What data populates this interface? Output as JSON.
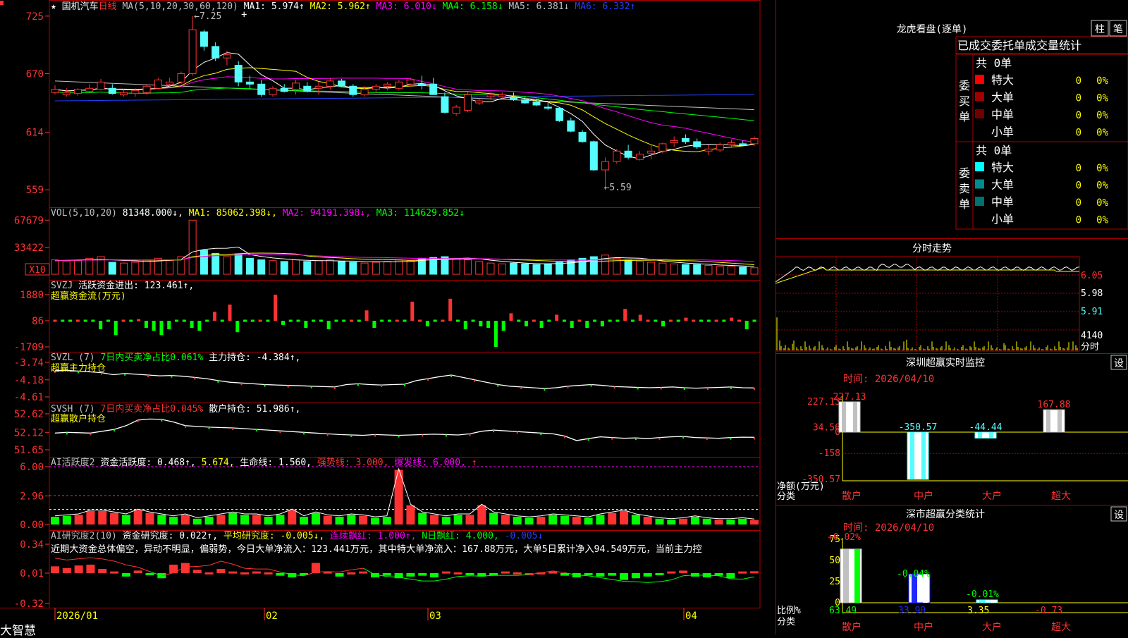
{
  "app": {
    "brand": "大智慧"
  },
  "header": {
    "star": "★",
    "stock_name": "国机汽车",
    "period": "日线",
    "ma_param": "MA(5,10,20,30,60,120)",
    "ma_items": [
      {
        "text": "MA1: 5.974↑",
        "color": "#ffffff"
      },
      {
        "text": "MA2: 5.962↑",
        "color": "#ffff00"
      },
      {
        "text": "MA3: 6.010↓",
        "color": "#ff00ff"
      },
      {
        "text": "MA4: 6.158↓",
        "color": "#00ff00"
      },
      {
        "text": "MA5: 6.381↓",
        "color": "#c0c0c0"
      },
      {
        "text": "MA6: 6.332↑",
        "color": "#2040ff"
      }
    ],
    "plus": "+"
  },
  "price_axis": [
    "725",
    "670",
    "614",
    "559"
  ],
  "price_annotations": {
    "high": "←7.25",
    "low": "←5.59"
  },
  "vol": {
    "title": "VOL(5,10,20)",
    "value": "81348.000↓,",
    "ma1": "MA1: 85062.398↓,",
    "ma2": "MA2: 94191.398↓,",
    "ma3": "MA3: 114629.852↓",
    "axis": [
      "67679",
      "33422"
    ],
    "unit": "X10"
  },
  "svzj": {
    "title": "SVZJ",
    "text": "活跃资金进出: 123.461↑,",
    "sub": "超赢资金流(万元)",
    "axis": [
      "1880",
      "86",
      "-1709"
    ]
  },
  "svzl": {
    "title": "SVZL (7)",
    "t1": "7日内买卖净占比0.061%",
    "t2": "主力持仓: -4.384↑,",
    "sub": "超赢主力持仓",
    "axis": [
      "-3.74",
      "-4.18",
      "-4.61"
    ]
  },
  "svsh": {
    "title": "SVSH (7)",
    "t1": "7日内买卖净占比0.045%",
    "t2": "散户持仓: 51.986↑,",
    "sub": "超赢散户持仓",
    "axis": [
      "52.62",
      "52.12",
      "51.65"
    ]
  },
  "ai1": {
    "title": "AI活跃度2",
    "t1": "资金活跃度: 0.468↑,",
    "t2": "5.674,",
    "t3": "生命线: 1.560,",
    "t4": "强势线: 3.000,",
    "t5": "爆发线: 6.000,",
    "t6": "↑",
    "axis": [
      "6.00",
      "2.96",
      "0.00"
    ]
  },
  "ai2": {
    "title": "AI研究度2(10)",
    "t1": "资金研究度: 0.022↑,",
    "t2": "平均研究度: -0.005↓,",
    "t3": "连续飘红: 1.000↑,",
    "t4": "N日飘红: 4.000,",
    "t5": "-0.005↓",
    "comment": "近期大资金总体偏空，异动不明显，偏弱势，今日大单净流入：123.441万元，其中特大单净流入：167.88万元，大单5日累计净入94.549万元，当前主力控",
    "axis": [
      "0.34",
      "0.01",
      "-0.32"
    ]
  },
  "date_axis": [
    "2026/01",
    "02",
    "03",
    "04"
  ],
  "dragon": {
    "title": "龙虎看盘(逐单)",
    "btn1": "柱",
    "btn2": "笔",
    "tabs": "已成交委托单成交量统计",
    "buy": {
      "side": "委买单",
      "total": "共 0单",
      "rows": [
        {
          "label": "特大",
          "color": "#ff0000",
          "v": "0",
          "p": "0%"
        },
        {
          "label": "大单",
          "color": "#a00000",
          "v": "0",
          "p": "0%"
        },
        {
          "label": "中单",
          "color": "#700000",
          "v": "0",
          "p": "0%"
        },
        {
          "label": "小单",
          "color": "#000000",
          "v": "0",
          "p": "0%"
        }
      ]
    },
    "sell": {
      "side": "委卖单",
      "total": "共 0单",
      "rows": [
        {
          "label": "特大",
          "color": "#00ffff",
          "v": "0",
          "p": "0%"
        },
        {
          "label": "大单",
          "color": "#008c8c",
          "v": "0",
          "p": "0%"
        },
        {
          "label": "中单",
          "color": "#007070",
          "v": "0",
          "p": "0%"
        },
        {
          "label": "小单",
          "color": "#000000",
          "v": "0",
          "p": "0%"
        }
      ]
    }
  },
  "fenshi": {
    "title": "分时走势",
    "axis": [
      "6.05",
      "5.98",
      "5.91"
    ],
    "vol": "4140",
    "unit": "分时"
  },
  "monitor": {
    "title": "深圳超赢实时监控",
    "setting": "设",
    "time": "时间: 2026/04/10",
    "axis": [
      "227.13",
      "34.56",
      "0",
      "-158",
      "-350.57"
    ],
    "ylabel": "净额(万元)",
    "xlabel": "分类",
    "cats": [
      "散户",
      "中户",
      "大户",
      "超大"
    ],
    "values": [
      "227.13",
      "-350.57",
      "-44.44",
      "167.88"
    ]
  },
  "stats": {
    "title": "深市超赢分类统计",
    "setting": "设",
    "time": "时间: 2026/04/10",
    "axis": [
      "75",
      "50",
      "25",
      "0"
    ],
    "ylabel": "比例%",
    "xlabel": "分类",
    "cats": [
      "散户",
      "中户",
      "大户",
      "超大"
    ],
    "top": [
      "+0.02%",
      "-0.04%",
      "-0.01%",
      ""
    ],
    "bottom": [
      "63.49",
      "33.90",
      "3.35",
      "-0.73"
    ]
  },
  "chart_data": {
    "type": "candlestick",
    "title": "国机汽车 日线",
    "x_start": "2026/01",
    "ylim": [
      5.45,
      7.35
    ],
    "ohlc": [
      [
        6.52,
        6.59,
        6.5,
        6.55
      ],
      [
        6.5,
        6.56,
        6.48,
        6.52
      ],
      [
        6.51,
        6.56,
        6.49,
        6.55
      ],
      [
        6.53,
        6.6,
        6.52,
        6.56
      ],
      [
        6.55,
        6.65,
        6.54,
        6.62
      ],
      [
        6.56,
        6.6,
        6.5,
        6.51
      ],
      [
        6.5,
        6.55,
        6.48,
        6.52
      ],
      [
        6.51,
        6.56,
        6.48,
        6.54
      ],
      [
        6.52,
        6.6,
        6.5,
        6.58
      ],
      [
        6.56,
        6.66,
        6.55,
        6.64
      ],
      [
        6.6,
        6.66,
        6.58,
        6.62
      ],
      [
        6.62,
        6.72,
        6.6,
        6.7
      ],
      [
        6.7,
        7.25,
        6.68,
        7.12
      ],
      [
        7.1,
        7.12,
        6.92,
        6.96
      ],
      [
        6.96,
        7.0,
        6.82,
        6.85
      ],
      [
        6.85,
        6.92,
        6.78,
        6.88
      ],
      [
        6.78,
        6.82,
        6.58,
        6.62
      ],
      [
        6.62,
        6.68,
        6.55,
        6.6
      ],
      [
        6.6,
        6.64,
        6.48,
        6.5
      ],
      [
        6.5,
        6.58,
        6.48,
        6.56
      ],
      [
        6.56,
        6.6,
        6.52,
        6.53
      ],
      [
        6.55,
        6.64,
        6.5,
        6.61
      ],
      [
        6.58,
        6.62,
        6.52,
        6.53
      ],
      [
        6.56,
        6.62,
        6.5,
        6.58
      ],
      [
        6.58,
        6.66,
        6.55,
        6.63
      ],
      [
        6.63,
        6.65,
        6.57,
        6.58
      ],
      [
        6.58,
        6.6,
        6.48,
        6.5
      ],
      [
        6.5,
        6.58,
        6.48,
        6.55
      ],
      [
        6.55,
        6.6,
        6.52,
        6.58
      ],
      [
        6.58,
        6.62,
        6.54,
        6.6
      ],
      [
        6.56,
        6.64,
        6.54,
        6.62
      ],
      [
        6.6,
        6.66,
        6.58,
        6.64
      ],
      [
        6.6,
        6.68,
        6.55,
        6.59
      ],
      [
        6.6,
        6.66,
        6.5,
        6.5
      ],
      [
        6.48,
        6.52,
        6.32,
        6.33
      ],
      [
        6.32,
        6.4,
        6.3,
        6.38
      ],
      [
        6.35,
        6.52,
        6.33,
        6.5
      ],
      [
        6.42,
        6.46,
        6.4,
        6.44
      ],
      [
        6.48,
        6.52,
        6.45,
        6.5
      ],
      [
        6.48,
        6.52,
        6.46,
        6.5
      ],
      [
        6.47,
        6.52,
        6.44,
        6.45
      ],
      [
        6.45,
        6.48,
        6.41,
        6.42
      ],
      [
        6.43,
        6.46,
        6.39,
        6.4
      ],
      [
        6.38,
        6.42,
        6.35,
        6.37
      ],
      [
        6.37,
        6.38,
        6.24,
        6.25
      ],
      [
        6.25,
        6.28,
        6.14,
        6.15
      ],
      [
        6.14,
        6.16,
        6.04,
        6.05
      ],
      [
        6.05,
        6.06,
        5.77,
        5.78
      ],
      [
        5.78,
        5.9,
        5.59,
        5.86
      ],
      [
        5.86,
        5.98,
        5.84,
        5.96
      ],
      [
        5.96,
        6.02,
        5.88,
        5.9
      ],
      [
        5.88,
        5.96,
        5.87,
        5.93
      ],
      [
        5.94,
        6.02,
        5.88,
        5.96
      ],
      [
        5.96,
        6.04,
        5.94,
        6.03
      ],
      [
        6.04,
        6.1,
        6.0,
        6.06
      ],
      [
        6.08,
        6.12,
        6.03,
        6.05
      ],
      [
        6.05,
        6.08,
        5.98,
        6.0
      ],
      [
        5.96,
        6.02,
        5.92,
        5.98
      ],
      [
        5.97,
        6.04,
        5.95,
        6.02
      ],
      [
        6.02,
        6.07,
        5.99,
        6.04
      ],
      [
        6.03,
        6.06,
        6.01,
        6.02
      ],
      [
        6.03,
        6.1,
        6.01,
        6.08
      ]
    ],
    "volume_ylim": [
      0,
      75000
    ],
    "volume": [
      18000,
      16000,
      17000,
      20000,
      22000,
      15000,
      14000,
      15000,
      18000,
      20000,
      17000,
      22000,
      67679,
      30000,
      26000,
      22000,
      25000,
      20000,
      18000,
      17000,
      16000,
      18000,
      16000,
      17000,
      18000,
      16000,
      15000,
      14000,
      15000,
      16000,
      18000,
      17000,
      20000,
      21000,
      22000,
      20000,
      18000,
      16000,
      14000,
      13000,
      14000,
      13000,
      12000,
      13000,
      15000,
      18000,
      20000,
      22000,
      24000,
      20000,
      18000,
      16000,
      15000,
      14000,
      13000,
      12000,
      12000,
      11000,
      10000,
      10000,
      9000,
      8134
    ],
    "vol_ma5": [
      17000,
      17500,
      17800,
      18200,
      18600,
      18000,
      17200,
      16800,
      16000,
      16600,
      17500,
      18500,
      28000,
      31000,
      32500,
      32600,
      34100,
      24600,
      22200,
      20400,
      19200,
      18000,
      17400,
      17000,
      17000,
      16600,
      16400,
      15800,
      15600,
      15400,
      15600,
      16000,
      17200,
      18400,
      19600,
      19800,
      20200,
      19400,
      17600,
      16200,
      15000,
      14000,
      13200,
      13000,
      13400,
      14200,
      15600,
      17800,
      19800,
      20800,
      20400,
      20000,
      18600,
      16600,
      15200,
      14000,
      13200,
      12400,
      11600,
      11000,
      10400,
      9627
    ],
    "vol_ma10": [
      17000,
      17200,
      17400,
      17700,
      18000,
      18100,
      18000,
      17900,
      17600,
      17600,
      17700,
      17800,
      22000,
      23500,
      24500,
      24800,
      25700,
      26400,
      26500,
      26400,
      26000,
      25300,
      22900,
      21600,
      21000,
      20300,
      19400,
      18800,
      18400,
      18300,
      17900,
      17400,
      17800,
      18100,
      18500,
      18700,
      19000,
      19300,
      19000,
      18700,
      18200,
      17700,
      17300,
      16700,
      16200,
      15900,
      15700,
      15900,
      16400,
      17000,
      17200,
      17400,
      17600,
      17700,
      17500,
      17000,
      16500,
      15600,
      14800,
      13900,
      13000,
      11900
    ],
    "vol_ma20": [
      17500,
      17500,
      17600,
      17700,
      17800,
      17800,
      17800,
      17800,
      17800,
      17900,
      18000,
      18100,
      21000,
      22200,
      23100,
      23500,
      24100,
      24400,
      24500,
      24500,
      24500,
      24400,
      23600,
      22900,
      22300,
      21900,
      21400,
      21100,
      20900,
      20700,
      20400,
      20100,
      19800,
      19600,
      19500,
      19500,
      19600,
      19500,
      19300,
      19000,
      18800,
      18500,
      18400,
      18100,
      17900,
      17700,
      17600,
      17800,
      18000,
      18300,
      18400,
      18600,
      18600,
      18500,
      18300,
      18100,
      18000,
      17700,
      17400,
      17200,
      16600,
      15900
    ],
    "svzj": [
      86,
      86,
      86,
      86,
      86,
      86,
      -500,
      86,
      -900,
      86,
      86,
      200,
      -400,
      -600,
      -900,
      -500,
      86,
      86,
      -400,
      -600,
      86,
      700,
      86,
      1200,
      -700,
      86,
      86,
      86,
      86,
      1880,
      -200,
      86,
      86,
      -400,
      86,
      86,
      -500,
      86,
      86,
      86,
      86,
      800,
      -400,
      86,
      86,
      86,
      86,
      1400,
      86,
      -300,
      86,
      86,
      1600,
      86,
      -500,
      86,
      -300,
      -400,
      -1709,
      -600,
      600,
      86,
      -300,
      86,
      -400,
      86,
      500,
      86,
      -400,
      86,
      -400,
      86,
      -300,
      86,
      86,
      900,
      86,
      500,
      86,
      86,
      -300,
      86,
      86,
      300,
      86,
      86,
      86,
      86,
      86,
      300,
      86,
      -500,
      86
    ],
    "svzl": [
      -3.95,
      -3.94,
      -3.96,
      -3.98,
      -4.0,
      -4.05,
      -4.02,
      -4.04,
      -4.06,
      -4.08,
      -4.07,
      -4.09,
      -4.12,
      -4.15,
      -4.2,
      -4.24,
      -4.26,
      -4.28,
      -4.3,
      -4.31,
      -4.32,
      -4.33,
      -4.34,
      -4.35,
      -4.36,
      -4.3,
      -4.28,
      -4.3,
      -4.31,
      -4.3,
      -4.29,
      -4.2,
      -4.15,
      -4.1,
      -4.06,
      -4.12,
      -4.18,
      -4.24,
      -4.3,
      -4.34,
      -4.36,
      -4.38,
      -4.4,
      -4.38,
      -4.34,
      -4.32,
      -4.3,
      -4.32,
      -4.35,
      -4.36,
      -4.37,
      -4.38,
      -4.37,
      -4.36,
      -4.38,
      -4.39,
      -4.38,
      -4.37,
      -4.36,
      -4.38,
      -4.384
    ],
    "svsh": [
      52.1,
      52.12,
      52.11,
      52.1,
      52.15,
      52.2,
      52.3,
      52.45,
      52.48,
      52.47,
      52.4,
      52.3,
      52.28,
      52.26,
      52.25,
      52.24,
      52.22,
      52.2,
      52.18,
      52.16,
      52.14,
      52.12,
      52.1,
      52.08,
      52.06,
      52.05,
      52.04,
      52.06,
      52.05,
      52.04,
      52.05,
      52.06,
      52.07,
      52.06,
      52.05,
      52.08,
      52.15,
      52.18,
      52.16,
      52.14,
      52.12,
      52.1,
      52.08,
      52.02,
      51.9,
      51.95,
      52.0,
      51.98,
      51.96,
      51.97,
      51.95,
      51.98,
      52.0,
      52.01,
      51.98,
      51.97,
      51.96,
      51.98,
      51.99,
      51.986
    ],
    "ai1": [
      0.8,
      0.9,
      1.0,
      1.4,
      1.4,
      1.2,
      1.0,
      1.5,
      1.2,
      1.0,
      0.8,
      1.0,
      0.6,
      0.8,
      1.0,
      1.2,
      1.0,
      1.0,
      0.8,
      1.0,
      1.5,
      0.8,
      1.2,
      0.9,
      0.8,
      1.0,
      0.9,
      0.7,
      0.8,
      5.674,
      2.0,
      1.2,
      1.0,
      0.8,
      1.0,
      1.0,
      2.0,
      1.2,
      1.0,
      0.8,
      0.7,
      0.8,
      1.0,
      0.9,
      0.8,
      0.7,
      1.0,
      1.2,
      1.4,
      1.0,
      0.8,
      0.6,
      0.5,
      0.6,
      0.8,
      0.6,
      0.5,
      0.5,
      0.6,
      0.468
    ],
    "ai2": [
      0.08,
      0.06,
      0.09,
      0.1,
      0.05,
      0.02,
      -0.04,
      0.03,
      -0.02,
      -0.06,
      0.1,
      0.12,
      0.04,
      0.01,
      0.05,
      0.02,
      0.01,
      0.02,
      0.01,
      -0.03,
      -0.05,
      -0.02,
      0.12,
      0.02,
      -0.04,
      0.01,
      0.02,
      -0.05,
      -0.03,
      -0.06,
      -0.04,
      -0.03,
      -0.05,
      0.02,
      0.01,
      -0.02,
      -0.04,
      -0.03,
      0.02,
      0.01,
      0.0,
      0.01,
      0.02,
      -0.03,
      -0.05,
      -0.02,
      -0.04,
      -0.03,
      -0.08,
      -0.06,
      -0.04,
      -0.02,
      0.02,
      0.03,
      -0.04,
      -0.05,
      -0.03,
      -0.06,
      0.02,
      0.022
    ]
  }
}
